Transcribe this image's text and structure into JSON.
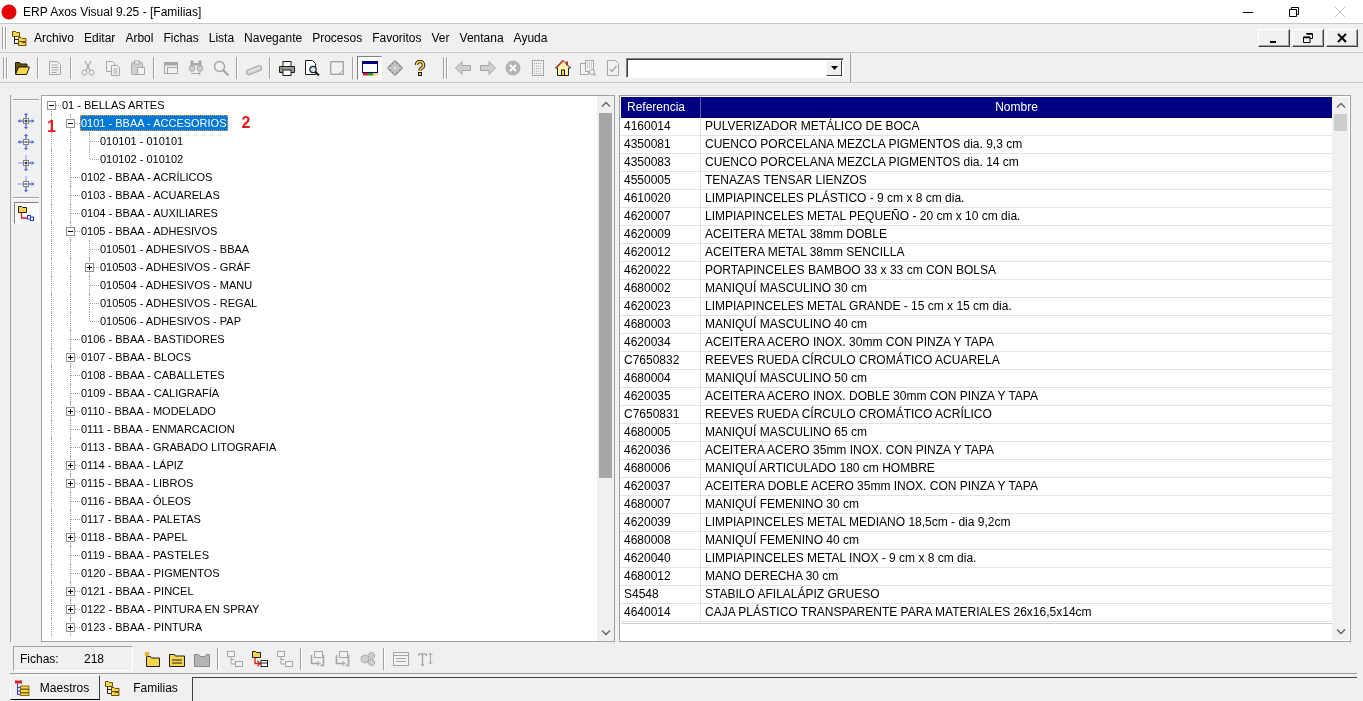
{
  "window": {
    "title": "ERP Axos Visual 9.25 - [Familias]",
    "controls": [
      {
        "disabled": false
      },
      {
        "disabled": false
      },
      {
        "disabled": true
      }
    ]
  },
  "menu": {
    "items": [
      {
        "label": "Archivo"
      },
      {
        "label": "Editar"
      },
      {
        "label": "Arbol"
      },
      {
        "label": "Fichas"
      },
      {
        "label": "Lista"
      },
      {
        "label": "Navegante"
      },
      {
        "label": "Procesos"
      },
      {
        "label": "Favoritos"
      },
      {
        "label": "Ver"
      },
      {
        "label": "Ventana"
      },
      {
        "label": "Ayuda"
      }
    ]
  },
  "toolbar": {
    "groups": [
      [
        {
          "disabled": false,
          "pressed": false
        }
      ],
      [
        {
          "disabled": true,
          "pressed": false
        }
      ],
      [
        {
          "disabled": true,
          "pressed": false
        },
        {
          "disabled": true,
          "pressed": false
        },
        {
          "disabled": true,
          "pressed": false
        }
      ],
      [
        {
          "disabled": true,
          "pressed": false
        },
        {
          "disabled": true,
          "pressed": false
        },
        {
          "disabled": true,
          "pressed": false
        }
      ],
      [
        {
          "disabled": true,
          "pressed": false
        }
      ],
      [
        {
          "disabled": false,
          "pressed": false
        },
        {
          "disabled": false,
          "pressed": false
        },
        {
          "disabled": true,
          "pressed": false
        }
      ],
      [
        {
          "disabled": false,
          "pressed": true
        },
        {
          "disabled": false,
          "pressed": false
        },
        {
          "disabled": false,
          "pressed": false
        }
      ]
    ]
  },
  "nav_toolbar": {
    "buttons": [
      {
        "disabled": true
      },
      {
        "disabled": true
      },
      {
        "disabled": true
      },
      {
        "disabled": true
      },
      {
        "disabled": false
      },
      {
        "disabled": true
      },
      {
        "disabled": true
      }
    ]
  },
  "side_toolbar": {
    "groups": [
      [
        {
          "pressed": false
        },
        {
          "pressed": false
        },
        {
          "pressed": false
        },
        {
          "pressed": false
        }
      ],
      [
        {
          "pressed": true
        }
      ]
    ]
  },
  "tree": {
    "nodes": [
      {
        "label": "01 - BELLAS ARTES",
        "kind": "branch",
        "expanded": true,
        "selected": false,
        "children": [
          {
            "label": "0101 - BBAA - ACCESORIOS",
            "kind": "branch",
            "expanded": true,
            "selected": true,
            "callouts": [
              "1",
              "2"
            ],
            "children": [
              {
                "label": "010101 - 010101",
                "kind": "leaf",
                "selected": false
              },
              {
                "label": "010102 - 010102",
                "kind": "leaf",
                "selected": false
              }
            ]
          },
          {
            "label": "0102 - BBAA - ACRÍLICOS",
            "kind": "leaf",
            "selected": false
          },
          {
            "label": "0103 - BBAA - ACUARELAS",
            "kind": "leaf",
            "selected": false
          },
          {
            "label": "0104 - BBAA - AUXILIARES",
            "kind": "leaf",
            "selected": false
          },
          {
            "label": "0105 - BBAA - ADHESIVOS",
            "kind": "branch",
            "expanded": true,
            "selected": false,
            "children": [
              {
                "label": "010501 - ADHESIVOS - BBAA",
                "kind": "leaf",
                "selected": false
              },
              {
                "label": "010503 - ADHESIVOS - GRÁF",
                "kind": "branch",
                "expanded": false,
                "selected": false
              },
              {
                "label": "010504 - ADHESIVOS - MANU",
                "kind": "leaf",
                "selected": false
              },
              {
                "label": "010505 - ADHESIVOS - REGAL",
                "kind": "leaf",
                "selected": false
              },
              {
                "label": "010506 - ADHESIVOS - PAP",
                "kind": "leaf",
                "selected": false
              }
            ]
          },
          {
            "label": "0106 - BBAA - BASTIDORES",
            "kind": "leaf",
            "selected": false
          },
          {
            "label": "0107 - BBAA - BLOCS",
            "kind": "branch",
            "expanded": false,
            "selected": false
          },
          {
            "label": "0108 - BBAA - CABALLETES",
            "kind": "leaf",
            "selected": false
          },
          {
            "label": "0109 - BBAA - CALIGRAFÍA",
            "kind": "leaf",
            "selected": false
          },
          {
            "label": "0110 - BBAA - MODELADO",
            "kind": "branch",
            "expanded": false,
            "selected": false
          },
          {
            "label": "0111 - BBAA - ENMARCACION",
            "kind": "leaf",
            "selected": false
          },
          {
            "label": "0113 - BBAA - GRABADO LITOGRAFIA",
            "kind": "leaf",
            "selected": false
          },
          {
            "label": "0114 - BBAA - LÁPIZ",
            "kind": "branch",
            "expanded": false,
            "selected": false
          },
          {
            "label": "0115 - BBAA - LIBROS",
            "kind": "branch",
            "expanded": false,
            "selected": false
          },
          {
            "label": "0116 - BBAA - ÓLEOS",
            "kind": "leaf",
            "selected": false
          },
          {
            "label": "0117 - BBAA - PALETAS",
            "kind": "leaf",
            "selected": false
          },
          {
            "label": "0118 - BBAA - PAPEL",
            "kind": "branch",
            "expanded": false,
            "selected": false
          },
          {
            "label": "0119 - BBAA - PASTELES",
            "kind": "leaf",
            "selected": false
          },
          {
            "label": "0120 - BBAA - PIGMENTOS",
            "kind": "leaf",
            "selected": false
          },
          {
            "label": "0121 - BBAA - PINCEL",
            "kind": "branch",
            "expanded": false,
            "selected": false
          },
          {
            "label": "0122 - BBAA - PINTURA EN SPRAY",
            "kind": "branch",
            "expanded": false,
            "selected": false
          },
          {
            "label": "0123 - BBAA - PINTURA",
            "kind": "branch",
            "expanded": false,
            "selected": false
          }
        ]
      }
    ]
  },
  "table": {
    "columns": [
      "Referencia",
      "Nombre"
    ],
    "rows": [
      {
        "cells": [
          "4160014",
          "PULVERIZADOR METÁLICO DE BOCA"
        ],
        "selected": false
      },
      {
        "cells": [
          "4350081",
          "CUENCO PORCELANA MEZCLA PIGMENTOS dia. 9,3 cm"
        ],
        "selected": false
      },
      {
        "cells": [
          "4350083",
          "CUENCO PORCELANA MEZCLA PIGMENTOS dia. 14 cm"
        ],
        "selected": false
      },
      {
        "cells": [
          "4550005",
          "TENAZAS TENSAR LIENZOS"
        ],
        "selected": false
      },
      {
        "cells": [
          "4610020",
          "LIMPIAPINCELES PLÁSTICO - 9 cm x 8 cm dia."
        ],
        "selected": false
      },
      {
        "cells": [
          "4620007",
          "LIMPIAPINCELES METAL PEQUEÑO - 20 cm x 10 cm dia."
        ],
        "selected": false
      },
      {
        "cells": [
          "4620009",
          "ACEITERA METAL 38mm DOBLE"
        ],
        "selected": false
      },
      {
        "cells": [
          "4620012",
          "ACEITERA METAL 38mm SENCILLA"
        ],
        "selected": false
      },
      {
        "cells": [
          "4620022",
          "PORTAPINCELES BAMBOO 33 x 33 cm CON BOLSA"
        ],
        "selected": false
      },
      {
        "cells": [
          "4680002",
          "MANIQUÍ MASCULINO 30 cm"
        ],
        "selected": false
      },
      {
        "cells": [
          "4620023",
          "LIMPIAPINCELES METAL GRANDE - 15 cm x 15 cm dia."
        ],
        "selected": false
      },
      {
        "cells": [
          "4680003",
          "MANIQUÍ MASCULINO 40 cm"
        ],
        "selected": false
      },
      {
        "cells": [
          "4620034",
          "ACEITERA ACERO INOX. 30mm CON PINZA Y TAPA"
        ],
        "selected": false
      },
      {
        "cells": [
          "C7650832",
          "REEVES RUEDA CÍRCULO CROMÁTICO ACUARELA"
        ],
        "selected": false
      },
      {
        "cells": [
          "4680004",
          "MANIQUÍ MASCULINO 50 cm"
        ],
        "selected": false
      },
      {
        "cells": [
          "4620035",
          "ACEITERA ACERO INOX. DOBLE 30mm CON PINZA Y TAPA"
        ],
        "selected": false
      },
      {
        "cells": [
          "C7650831",
          "REEVES RUEDA CÍRCULO CROMÁTICO ACRÍLICO"
        ],
        "selected": false
      },
      {
        "cells": [
          "4680005",
          "MANIQUÍ MASCULINO 65 cm"
        ],
        "selected": false
      },
      {
        "cells": [
          "4620036",
          "ACEITERA ACERO 35mm INOX. CON PINZA Y TAPA"
        ],
        "selected": false
      },
      {
        "cells": [
          "4680006",
          "MANIQUÍ ARTICULADO 180 cm HOMBRE"
        ],
        "selected": false
      },
      {
        "cells": [
          "4620037",
          "ACEITERA DOBLE ACERO 35mm INOX. CON PINZA Y TAPA"
        ],
        "selected": false
      },
      {
        "cells": [
          "4680007",
          "MANIQUÍ FEMENINO 30 cm"
        ],
        "selected": false
      },
      {
        "cells": [
          "4620039",
          "LIMPIAPINCELES METAL MEDIANO 18,5cm - dia 9,2cm"
        ],
        "selected": false
      },
      {
        "cells": [
          "4680008",
          "MANIQUÍ FEMENINO 40 cm"
        ],
        "selected": false
      },
      {
        "cells": [
          "4620040",
          "LIMPIAPINCELES METAL INOX - 9 cm x 8 cm dia."
        ],
        "selected": false
      },
      {
        "cells": [
          "4680012",
          "MANO DERECHA 30 cm"
        ],
        "selected": false
      },
      {
        "cells": [
          "S4548",
          "STABILO AFILALÁPIZ GRUESO"
        ],
        "selected": false
      },
      {
        "cells": [
          "4640014",
          "CAJA PLÁSTICO TRANSPARENTE PARA MATERIALES 26x16,5x14cm"
        ],
        "selected": false
      }
    ]
  },
  "status_bar": {
    "label": "Fichas:",
    "value": "218",
    "groups": [
      [
        {
          "disabled": false
        },
        {
          "disabled": false
        },
        {
          "disabled": true
        }
      ],
      [
        {
          "disabled": true
        },
        {
          "disabled": false
        },
        {
          "disabled": true
        }
      ],
      [
        {
          "disabled": true
        },
        {
          "disabled": true
        },
        {
          "disabled": true
        }
      ],
      [
        {
          "disabled": true
        },
        {
          "disabled": true
        }
      ]
    ]
  },
  "tabs": [
    {
      "label": "Maestros",
      "selected": false
    },
    {
      "label": "Familias",
      "selected": true
    }
  ]
}
